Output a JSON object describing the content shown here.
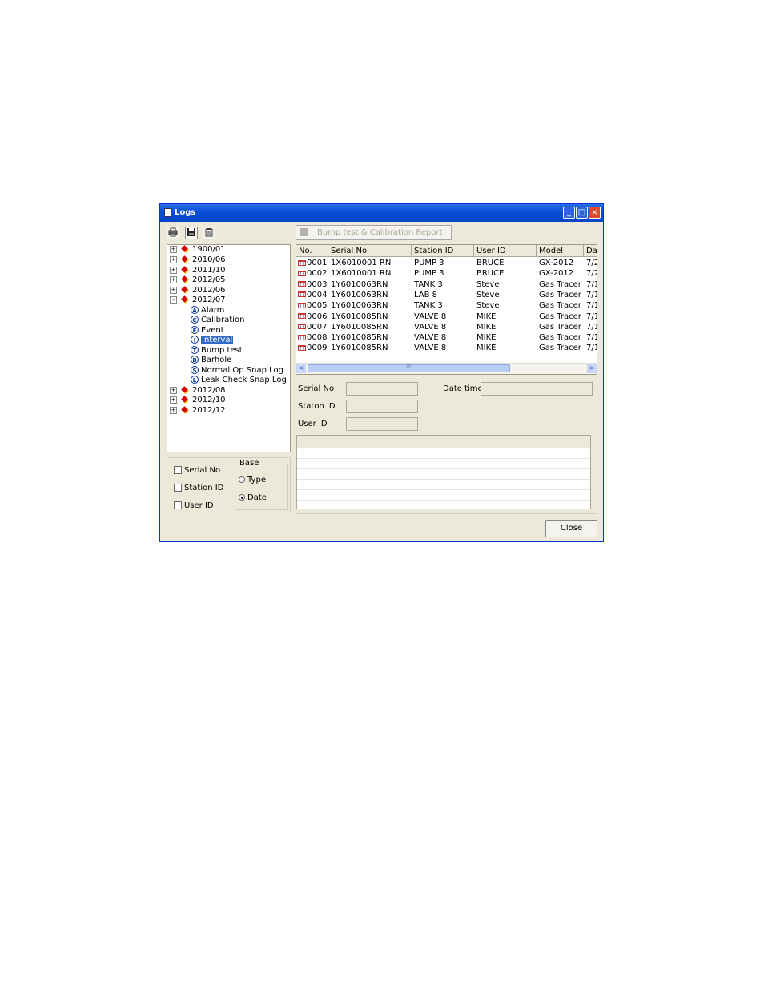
{
  "window": {
    "title": "Logs",
    "minimize_glyph": "_",
    "maximize_glyph": "□",
    "close_glyph": "×"
  },
  "toolbar": {
    "icons": [
      "printer-icon",
      "save-icon",
      "clipboard-icon"
    ],
    "report_button_label": "Bump test & Calibration Report"
  },
  "tree": {
    "items": [
      {
        "label": "1900/01",
        "expander": "+"
      },
      {
        "label": "2010/06",
        "expander": "+"
      },
      {
        "label": "2011/10",
        "expander": "+"
      },
      {
        "label": "2012/05",
        "expander": "+"
      },
      {
        "label": "2012/06",
        "expander": "+"
      },
      {
        "label": "2012/07",
        "expander": "-"
      },
      {
        "label": "Alarm",
        "badge": "A"
      },
      {
        "label": "Calibration",
        "badge": "C"
      },
      {
        "label": "Event",
        "badge": "E"
      },
      {
        "label": "Interval",
        "badge": "I",
        "selected": true
      },
      {
        "label": "Bump test",
        "badge": "T"
      },
      {
        "label": "Barhole",
        "badge": "B"
      },
      {
        "label": "Normal Op Snap Log",
        "badge": "S"
      },
      {
        "label": "Leak Check Snap Log",
        "badge": "L"
      },
      {
        "label": "2012/08",
        "expander": "+"
      },
      {
        "label": "2012/10",
        "expander": "+"
      },
      {
        "label": "2012/12",
        "expander": "+"
      }
    ]
  },
  "filters": {
    "serial_no": "Serial No",
    "station_id": "Station ID",
    "user_id": "User ID",
    "base_label": "Base",
    "type_label": "Type",
    "date_label": "Date",
    "selected_base": "Date"
  },
  "table": {
    "columns": [
      "No.",
      "Serial No",
      "Station ID",
      "User ID",
      "Model",
      "Da"
    ],
    "rows": [
      [
        "0001",
        "1X6010001 RN",
        "PUMP 3",
        "BRUCE",
        "GX-2012",
        "7/2"
      ],
      [
        "0002",
        "1X6010001 RN",
        "PUMP 3",
        "BRUCE",
        "GX-2012",
        "7/2"
      ],
      [
        "0003",
        "1Y6010063RN",
        "TANK 3",
        "Steve",
        "Gas Tracer",
        "7/1"
      ],
      [
        "0004",
        "1Y6010063RN",
        "LAB 8",
        "Steve",
        "Gas Tracer",
        "7/1"
      ],
      [
        "0005",
        "1Y6010063RN",
        "TANK 3",
        "Steve",
        "Gas Tracer",
        "7/1"
      ],
      [
        "0006",
        "1Y6010085RN",
        "VALVE 8",
        "MIKE",
        "Gas Tracer",
        "7/1"
      ],
      [
        "0007",
        "1Y6010085RN",
        "VALVE 8",
        "MIKE",
        "Gas Tracer",
        "7/1"
      ],
      [
        "0008",
        "1Y6010085RN",
        "VALVE 8",
        "MIKE",
        "Gas Tracer",
        "7/1"
      ],
      [
        "0009",
        "1Y6010085RN",
        "VALVE 8",
        "MIKE",
        "Gas Tracer",
        "7/1"
      ]
    ],
    "scroll_left_glyph": "<",
    "scroll_right_glyph": ">",
    "scroll_grip": "III"
  },
  "details": {
    "serial_no_label": "Serial No",
    "date_time_label": "Date time",
    "station_id_label": "Staton ID",
    "user_id_label": "User ID"
  },
  "footer": {
    "close_label": "Close"
  }
}
